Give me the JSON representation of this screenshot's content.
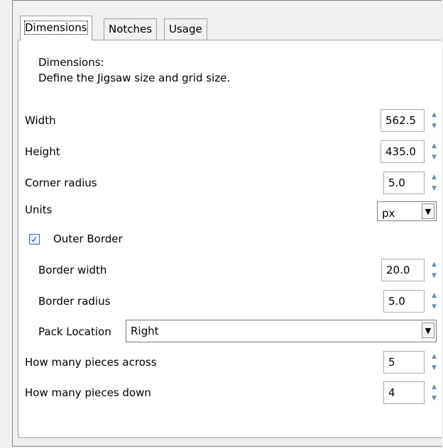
{
  "tabs": [
    {
      "label": "Dimensions",
      "active": true
    },
    {
      "label": "Notches",
      "active": false
    },
    {
      "label": "Usage",
      "active": false
    }
  ],
  "description": {
    "line1": "Dimensions:",
    "line2": "Define the Jigsaw size and grid size."
  },
  "fields": {
    "width": {
      "label": "Width",
      "value": "562.5"
    },
    "height": {
      "label": "Height",
      "value": "435.0"
    },
    "corner_radius": {
      "label": "Corner radius",
      "value": "5.0"
    },
    "units": {
      "label": "Units",
      "value": "px"
    },
    "outer_border": {
      "label": "Outer Border",
      "checked": true
    },
    "border_width": {
      "label": "Border width",
      "value": "20.0"
    },
    "border_radius": {
      "label": "Border radius",
      "value": "5.0"
    },
    "pack_location": {
      "label": "Pack Location",
      "value": "Right"
    },
    "pieces_across": {
      "label": "How many pieces across",
      "value": "5"
    },
    "pieces_down": {
      "label": "How many pieces down",
      "value": "4"
    }
  },
  "icons": {
    "spin_up": "▲",
    "spin_down": "▼",
    "dropdown": "▼",
    "check": "✓"
  }
}
